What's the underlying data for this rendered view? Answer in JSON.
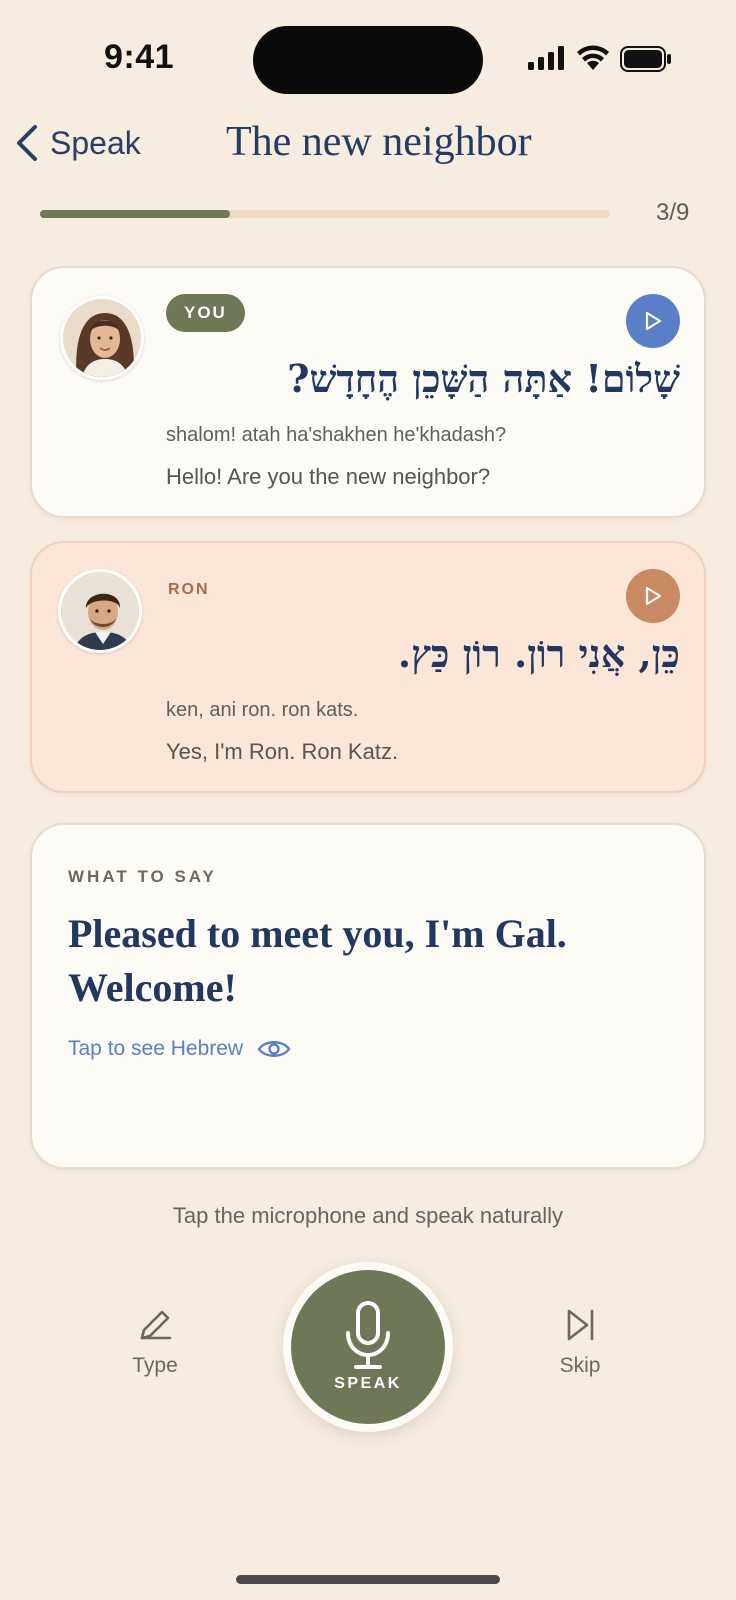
{
  "status": {
    "time": "9:41"
  },
  "header": {
    "back_label": "Speak",
    "title": "The new neighbor"
  },
  "progress": {
    "current": 3,
    "total": 9,
    "label": "3/9"
  },
  "messages": [
    {
      "speaker": "YOU",
      "hebrew": "שָׁלוֹם! אַתָּה הַשָּׁכֵן הֶחָדָשׁ?",
      "transliteration": "shalom! atah ha'shakhen he'khadash?",
      "english": "Hello! Are you the new neighbor?",
      "avatar": "woman-avatar",
      "accent": "#5b7fc6"
    },
    {
      "speaker": "RON",
      "hebrew": "כֵּן, אֲנִי רוֹן. רוֹן כַּץ.",
      "transliteration": "ken, ani ron. ron kats.",
      "english": "Yes, I'm Ron. Ron Katz.",
      "avatar": "man-avatar",
      "accent": "#c98a63"
    }
  ],
  "prompt": {
    "label": "WHAT TO SAY",
    "text": "Pleased to meet you, I'm Gal. Welcome!",
    "reveal_label": "Tap to see Hebrew"
  },
  "hint": "Tap the microphone and speak naturally",
  "actions": {
    "type_label": "Type",
    "speak_label": "SPEAK",
    "skip_label": "Skip"
  },
  "colors": {
    "background": "#f6ecdf",
    "olive": "#6f7856",
    "navy": "#233860",
    "blue": "#5b7fc6",
    "terracotta": "#c98a63"
  }
}
